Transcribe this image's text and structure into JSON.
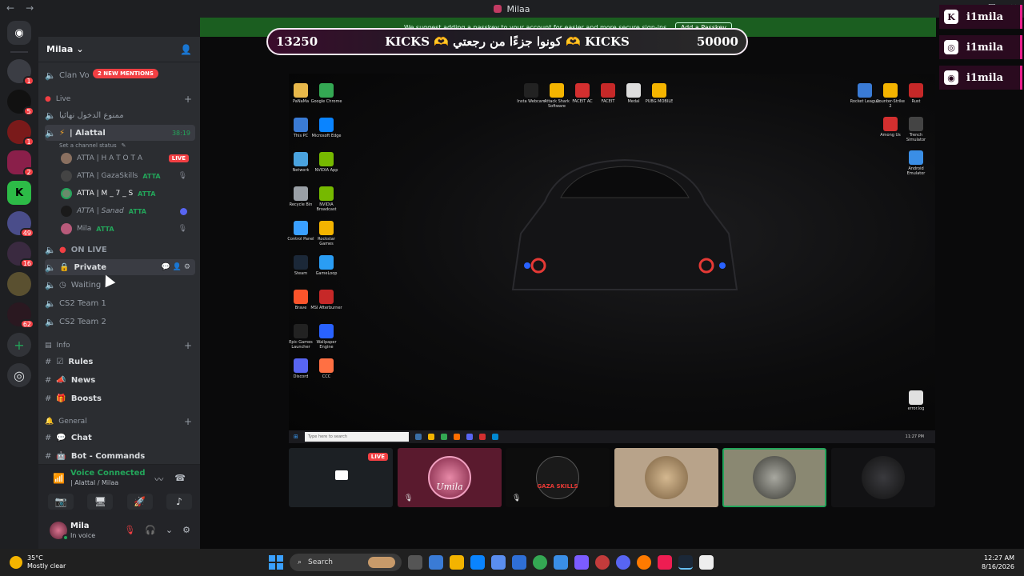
{
  "window": {
    "title": "Milaa"
  },
  "server": {
    "name": "Milaa"
  },
  "mentions_pill": "2 NEW MENTIONS",
  "guild_badges": [
    "1",
    "5",
    "1",
    "2",
    "49",
    "16",
    "62"
  ],
  "channels": {
    "clan_voice": "Clan Vo",
    "live_category": "Live",
    "locked_text": "ممنوع الدخول نهائيا",
    "alattal": "| Alattal",
    "alattal_time": "38:19",
    "channel_status": "Set a channel status",
    "on_live": "ON LIVE",
    "private": "Private",
    "waiting": "Waiting",
    "cs2_team1": "CS2 Team 1",
    "cs2_team2": "CS2 Team 2",
    "info_category": "Info",
    "rules": "Rules",
    "news": "News",
    "boosts": "Boosts",
    "general_category": "General",
    "chat": "Chat",
    "bot_commands": "Bot - Commands"
  },
  "voice_members": [
    {
      "name": "ATTA | H A T O T A",
      "tag": "",
      "badge": "LIVE"
    },
    {
      "name": "ATTA | GazaSkills",
      "tag": "ATTA",
      "badge": ""
    },
    {
      "name": "ATTA | M _ 7 _ S",
      "tag": "ATTA",
      "badge": ""
    },
    {
      "name": "ATTA | Sanad",
      "tag": "ATTA",
      "badge": ""
    },
    {
      "name": "Mila",
      "tag": "ATTA",
      "badge": ""
    }
  ],
  "voice": {
    "status": "Voice Connected",
    "location": "| Alattal / Milaa"
  },
  "user": {
    "name": "Mila",
    "status": "In voice"
  },
  "banner": {
    "text": "We suggest adding a passkey to your account for easier and more secure sign-ins.",
    "button": "Add a Passkey"
  },
  "kicks": {
    "left": "13250",
    "middle": "KICKS 🫶 كونوا جزءًا من رجعتي 🫶 KICKS",
    "right": "50000"
  },
  "kick_overlay": [
    "i1mila",
    "i1mila",
    "i1mila"
  ],
  "desktop_icons_left": [
    "PaNaMa",
    "Google Chrome",
    "This PC",
    "Microsoft Edge",
    "Network",
    "NVIDIA App",
    "Recycle Bin",
    "NVIDIA Broadcast",
    "Control Panel",
    "Rockstar Games",
    "Steam",
    "GameLoop",
    "Brave",
    "MSI Afterburner",
    "Epic Games Launcher",
    "Wallpaper Engine",
    "Discord",
    "CCC"
  ],
  "desktop_icons_top": [
    "Insta Webcam",
    "Attack Shark Software",
    "FACEIT AC",
    "FACEIT",
    "Medal",
    "PUBG MOBILE"
  ],
  "desktop_icons_right": [
    "Rocket League",
    "Counter-Strike 2",
    "Rust",
    "Among Us",
    "Trench Simulator",
    "Android Emulator",
    "error.log"
  ],
  "inner_taskbar": {
    "search": "Type here to search",
    "time": "11:27 PM"
  },
  "stream_tiles": [
    {
      "kind": "screen",
      "live": "LIVE"
    },
    {
      "kind": "avatar",
      "label": "Umila"
    },
    {
      "kind": "avatar",
      "label": "GAZA SKILLS"
    },
    {
      "kind": "video",
      "label": ""
    },
    {
      "kind": "avatar",
      "label": ""
    },
    {
      "kind": "avatar",
      "label": ""
    }
  ],
  "taskbar": {
    "weather_temp": "35°C",
    "weather_desc": "Mostly clear",
    "search": "Search",
    "time": "12:27 AM",
    "date": "8/16/2026"
  }
}
